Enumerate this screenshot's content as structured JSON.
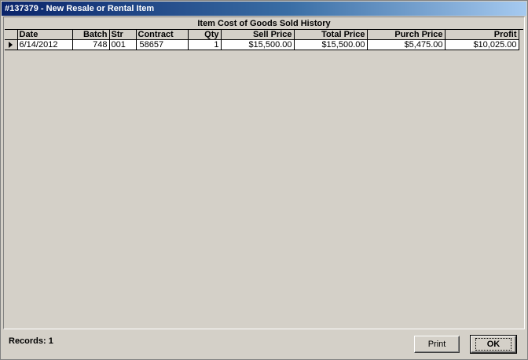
{
  "window": {
    "title": "#137379 - New Resale or Rental Item"
  },
  "grid": {
    "caption": "Item Cost of Goods Sold History",
    "columns": [
      "Date",
      "Batch",
      "Str",
      "Contract",
      "Qty",
      "Sell Price",
      "Total Price",
      "Purch Price",
      "Profit"
    ],
    "rows": [
      {
        "date": "6/14/2012",
        "batch": "748",
        "str": "001",
        "contract": "58657",
        "qty": "1",
        "sell_price": "$15,500.00",
        "total_price": "$15,500.00",
        "purch_price": "$5,475.00",
        "profit": "$10,025.00"
      }
    ]
  },
  "footer": {
    "records_label": "Records: 1",
    "print_label": "Print",
    "ok_label": "OK"
  },
  "colors": {
    "titlebar_start": "#0a246a",
    "titlebar_end": "#a6caf0",
    "face": "#d4d0c8"
  }
}
